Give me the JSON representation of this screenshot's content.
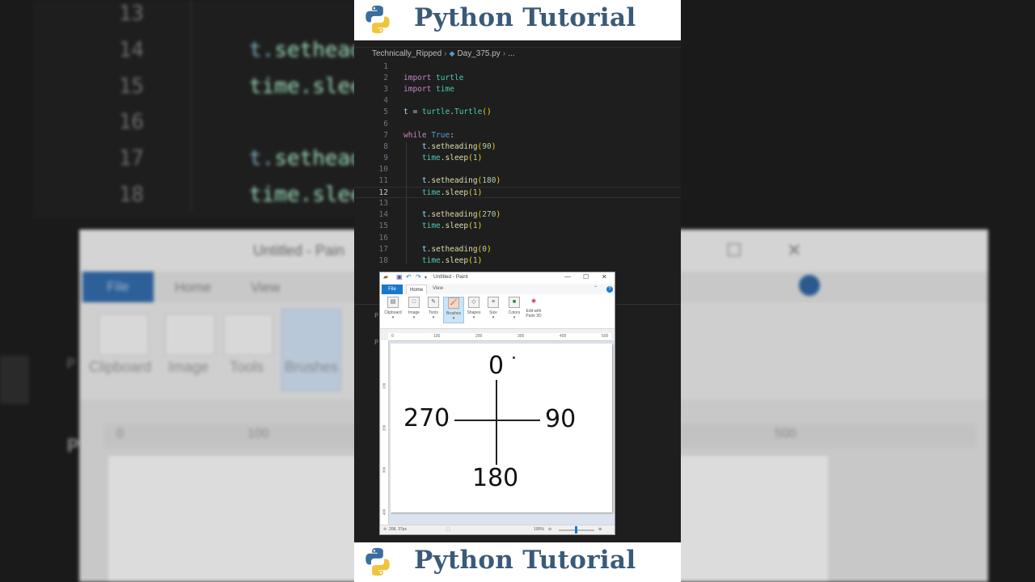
{
  "background": {
    "code_lines": [
      {
        "num": "13",
        "text": ""
      },
      {
        "num": "14",
        "obj": "t.",
        "fn": "setheadi"
      },
      {
        "num": "15",
        "obj": "time.",
        "fn": "sleep"
      },
      {
        "num": "16",
        "text": ""
      },
      {
        "num": "17",
        "obj": "t.",
        "fn": "setheadi"
      },
      {
        "num": "18",
        "obj": "time.",
        "fn": "sleep"
      }
    ],
    "paint": {
      "title": "Untitled - Pain",
      "tab_file": "File",
      "tab_home": "Home",
      "tab_view": "View",
      "tools": [
        "Clipboard",
        "Image",
        "Tools",
        "Brushes"
      ],
      "ruler": [
        "0",
        "100",
        "500"
      ],
      "side_letter": "P"
    }
  },
  "banner": {
    "title": "Python Tutorial"
  },
  "editor": {
    "breadcrumb": {
      "folder": "Technically_Ripped",
      "file": "Day_375.py",
      "rest": "..."
    },
    "current_line": 12,
    "lines": [
      {
        "n": "1",
        "tokens": []
      },
      {
        "n": "2",
        "tokens": [
          {
            "t": "import ",
            "c": "kw"
          },
          {
            "t": "turtle",
            "c": "mod"
          }
        ]
      },
      {
        "n": "3",
        "tokens": [
          {
            "t": "import ",
            "c": "kw"
          },
          {
            "t": "time",
            "c": "mod"
          }
        ]
      },
      {
        "n": "4",
        "tokens": []
      },
      {
        "n": "5",
        "tokens": [
          {
            "t": "t ",
            "c": "var"
          },
          {
            "t": "= ",
            "c": "plain"
          },
          {
            "t": "turtle",
            "c": "mod"
          },
          {
            "t": ".",
            "c": "plain"
          },
          {
            "t": "Turtle",
            "c": "mod"
          },
          {
            "t": "()",
            "c": "pun"
          }
        ]
      },
      {
        "n": "6",
        "tokens": []
      },
      {
        "n": "7",
        "tokens": [
          {
            "t": "while ",
            "c": "kw"
          },
          {
            "t": "True",
            "c": "kwb"
          },
          {
            "t": ":",
            "c": "plain"
          }
        ]
      },
      {
        "n": "8",
        "tokens": [
          {
            "t": "    t",
            "c": "var"
          },
          {
            "t": ".",
            "c": "plain"
          },
          {
            "t": "setheading",
            "c": "fn"
          },
          {
            "t": "(",
            "c": "pun"
          },
          {
            "t": "90",
            "c": "num"
          },
          {
            "t": ")",
            "c": "pun"
          }
        ]
      },
      {
        "n": "9",
        "tokens": [
          {
            "t": "    time",
            "c": "mod"
          },
          {
            "t": ".",
            "c": "plain"
          },
          {
            "t": "sleep",
            "c": "fn"
          },
          {
            "t": "(",
            "c": "pun"
          },
          {
            "t": "1",
            "c": "num"
          },
          {
            "t": ")",
            "c": "pun"
          }
        ]
      },
      {
        "n": "10",
        "tokens": []
      },
      {
        "n": "11",
        "tokens": [
          {
            "t": "    t",
            "c": "var"
          },
          {
            "t": ".",
            "c": "plain"
          },
          {
            "t": "setheading",
            "c": "fn"
          },
          {
            "t": "(",
            "c": "pun"
          },
          {
            "t": "180",
            "c": "num"
          },
          {
            "t": ")",
            "c": "pun"
          }
        ]
      },
      {
        "n": "12",
        "tokens": [
          {
            "t": "    time",
            "c": "mod"
          },
          {
            "t": ".",
            "c": "plain"
          },
          {
            "t": "sleep",
            "c": "fn"
          },
          {
            "t": "(",
            "c": "pun"
          },
          {
            "t": "1",
            "c": "num"
          },
          {
            "t": ")",
            "c": "pun"
          }
        ]
      },
      {
        "n": "13",
        "tokens": []
      },
      {
        "n": "14",
        "tokens": [
          {
            "t": "    t",
            "c": "var"
          },
          {
            "t": ".",
            "c": "plain"
          },
          {
            "t": "setheading",
            "c": "fn"
          },
          {
            "t": "(",
            "c": "pun"
          },
          {
            "t": "270",
            "c": "num"
          },
          {
            "t": ")",
            "c": "pun"
          }
        ]
      },
      {
        "n": "15",
        "tokens": [
          {
            "t": "    time",
            "c": "mod"
          },
          {
            "t": ".",
            "c": "plain"
          },
          {
            "t": "sleep",
            "c": "fn"
          },
          {
            "t": "(",
            "c": "pun"
          },
          {
            "t": "1",
            "c": "num"
          },
          {
            "t": ")",
            "c": "pun"
          }
        ]
      },
      {
        "n": "16",
        "tokens": []
      },
      {
        "n": "17",
        "tokens": [
          {
            "t": "    t",
            "c": "var"
          },
          {
            "t": ".",
            "c": "plain"
          },
          {
            "t": "setheading",
            "c": "fn"
          },
          {
            "t": "(",
            "c": "pun"
          },
          {
            "t": "0",
            "c": "num"
          },
          {
            "t": ")",
            "c": "pun"
          }
        ]
      },
      {
        "n": "18",
        "tokens": [
          {
            "t": "    time",
            "c": "mod"
          },
          {
            "t": ".",
            "c": "plain"
          },
          {
            "t": "sleep",
            "c": "fn"
          },
          {
            "t": "(",
            "c": "pun"
          },
          {
            "t": "1",
            "c": "num"
          },
          {
            "t": ")",
            "c": "pun"
          }
        ]
      }
    ],
    "side_letter": "P"
  },
  "paint": {
    "title": "Untitled - Paint",
    "tabs": {
      "file": "File",
      "home": "Home",
      "view": "View"
    },
    "groups": [
      {
        "label": "Clipboard",
        "icon": "clipboard-icon",
        "glyph": "▤"
      },
      {
        "label": "Image",
        "icon": "image-icon",
        "glyph": "□"
      },
      {
        "label": "Tools",
        "icon": "tools-icon",
        "glyph": "✎"
      },
      {
        "label": "Brushes",
        "icon": "brush-icon",
        "glyph": "🖌"
      },
      {
        "label": "Shapes",
        "icon": "shapes-icon",
        "glyph": "◇"
      },
      {
        "label": "Size",
        "icon": "size-icon",
        "glyph": "≡"
      },
      {
        "label": "Colors",
        "icon": "colors-icon",
        "glyph": "■"
      },
      {
        "label": "Edit with Paint 3D",
        "icon": "paint3d-icon",
        "glyph": "◉"
      }
    ],
    "ruler_top": [
      "0",
      "100",
      "200",
      "300",
      "400",
      "500"
    ],
    "ruler_left": [
      "100",
      "200",
      "300",
      "400"
    ],
    "status_coords": "208, 37px",
    "zoom": "100%",
    "canvas_labels": {
      "top": "0",
      "left": "270",
      "right": "90",
      "bottom": "180"
    }
  },
  "colors": {
    "banner_text": "#3a5a78",
    "file_tab": "#1979ca",
    "editor_bg": "#1e1e1e"
  }
}
